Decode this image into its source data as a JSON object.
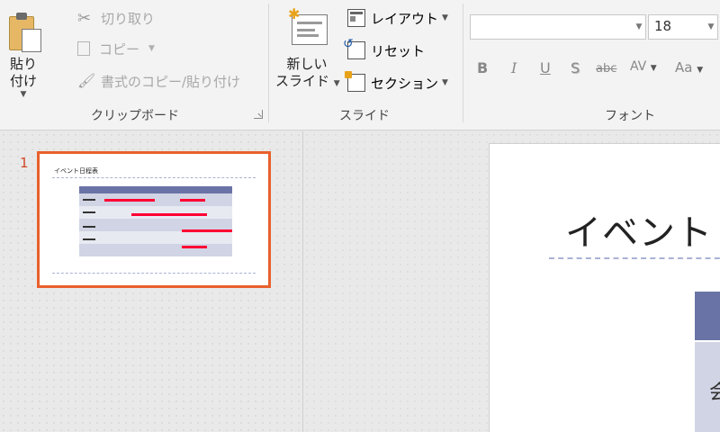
{
  "ribbon": {
    "clipboard": {
      "paste_label": "貼り付け",
      "cut_label": "切り取り",
      "copy_label": "コピー",
      "format_painter_label": "書式のコピー/貼り付け",
      "group_label": "クリップボード"
    },
    "slides": {
      "new_slide_line1": "新しい",
      "new_slide_line2": "スライド",
      "layout_label": "レイアウト",
      "reset_label": "リセット",
      "section_label": "セクション",
      "group_label": "スライド"
    },
    "font": {
      "font_name_value": "",
      "font_size_value": "18",
      "bold": "B",
      "italic": "I",
      "underline": "U",
      "shadow": "S",
      "strikethrough": "abc",
      "char_spacing": "AV",
      "change_case": "Aa",
      "group_label": "フォント"
    }
  },
  "thumbnails": {
    "slide_number": "1",
    "slide_title": "イベント日程表"
  },
  "slide": {
    "title": "イベント",
    "cell_text": "会"
  },
  "colors": {
    "accent_selection": "#e8602c",
    "table_header": "#6a73a6",
    "table_body": "#d0d4e4",
    "gantt_bar": "#ff0033"
  }
}
